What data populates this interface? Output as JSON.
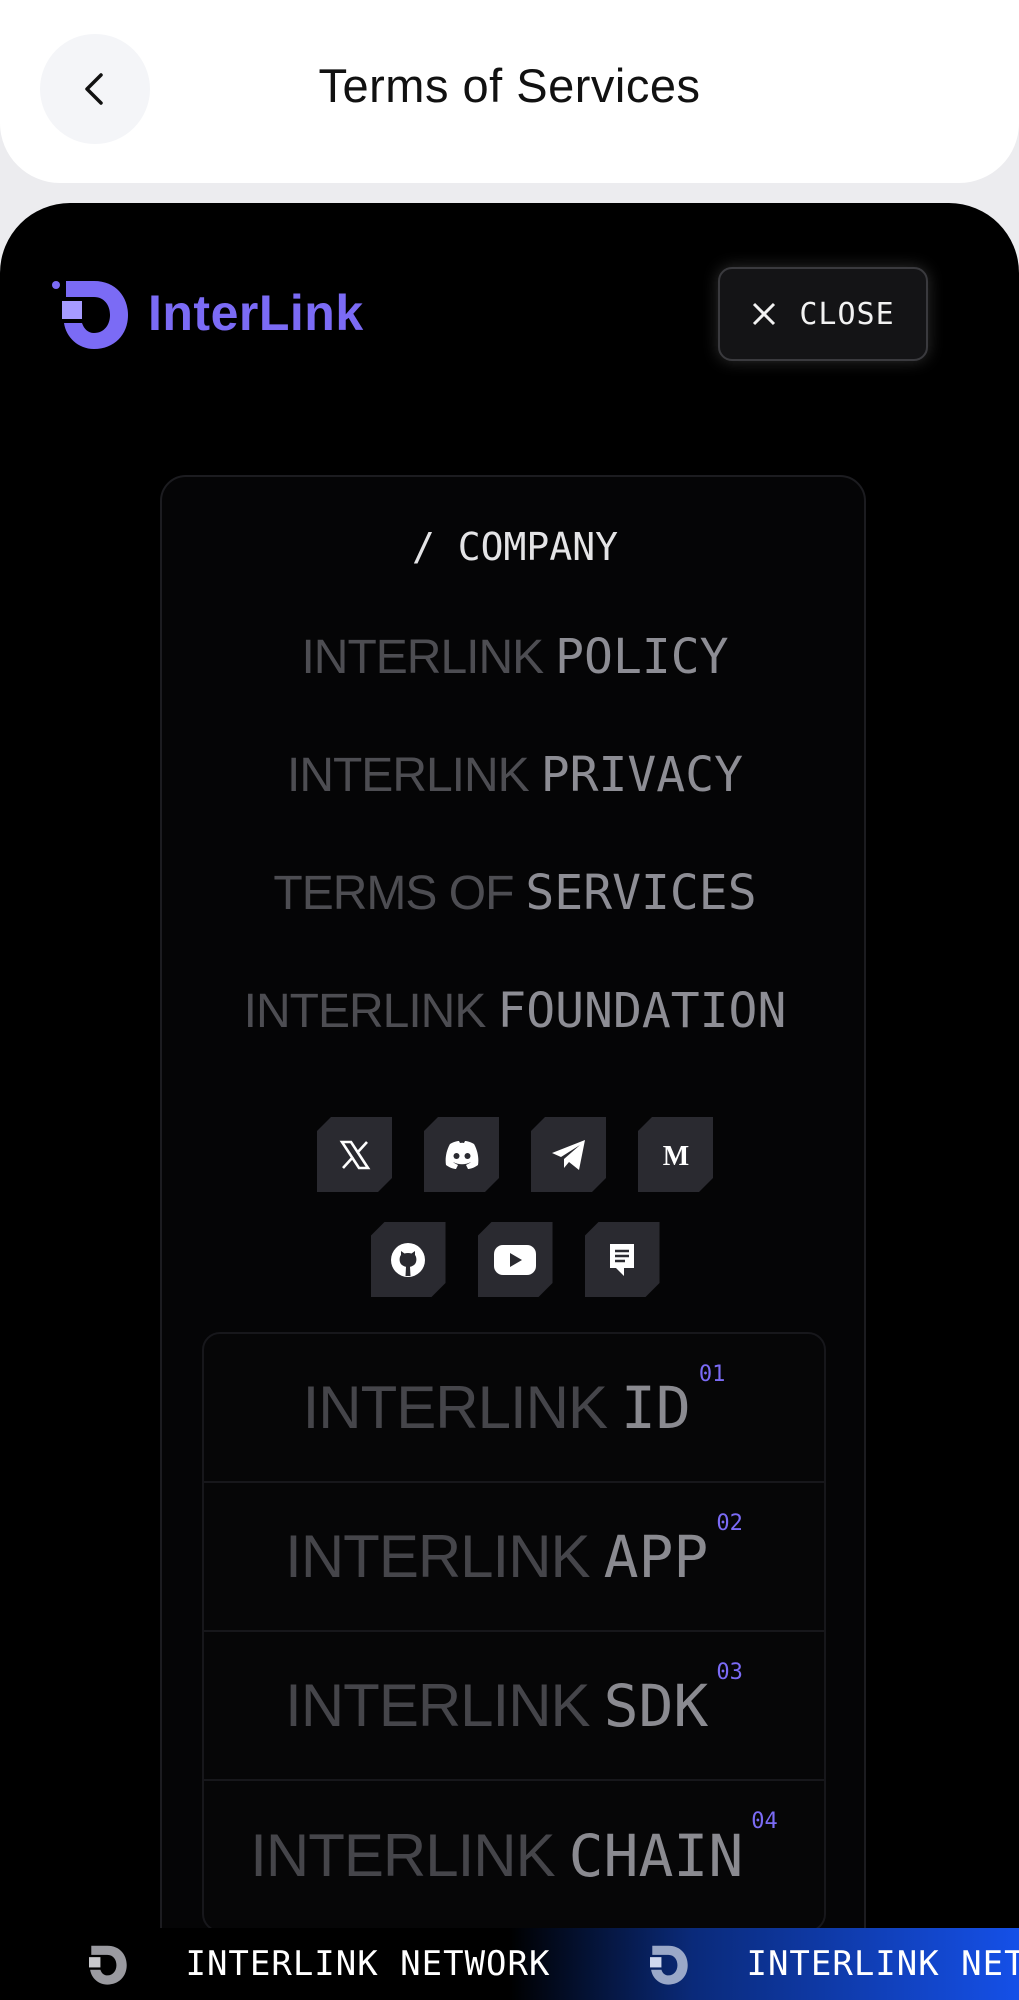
{
  "appbar": {
    "title": "Terms of Services"
  },
  "brand": {
    "name": "InterLink",
    "accent": "#7b6bf5"
  },
  "close_button": {
    "label": "CLOSE"
  },
  "menu": {
    "heading": "/ COMPANY",
    "links": [
      {
        "dim": "INTERLINK",
        "bright": "POLICY"
      },
      {
        "dim": "INTERLINK",
        "bright": "PRIVACY"
      },
      {
        "dim": "TERMS OF",
        "bright": "SERVICES"
      },
      {
        "dim": "INTERLINK",
        "bright": "FOUNDATION"
      }
    ],
    "socials": [
      "x-icon",
      "discord-icon",
      "telegram-icon",
      "medium-icon",
      "github-icon",
      "youtube-icon",
      "docs-icon"
    ],
    "products": [
      {
        "dim": "INTERLINK",
        "bright": "ID",
        "num": "01"
      },
      {
        "dim": "INTERLINK",
        "bright": "APP",
        "num": "02"
      },
      {
        "dim": "INTERLINK",
        "bright": "SDK",
        "num": "03"
      },
      {
        "dim": "INTERLINK",
        "bright": "CHAIN",
        "num": "04"
      }
    ]
  },
  "ticker": {
    "text": "INTERLINK NETWORK",
    "fragment": "K"
  }
}
